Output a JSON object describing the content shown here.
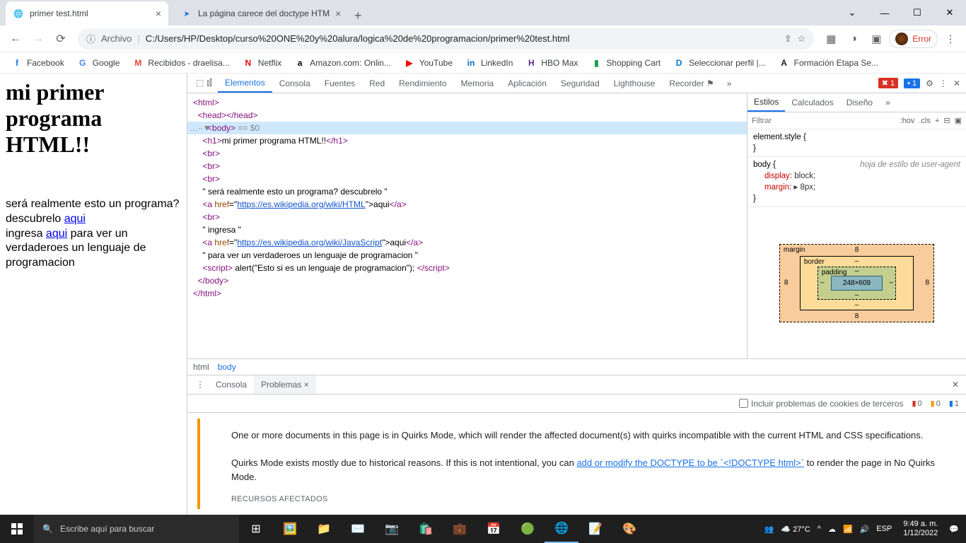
{
  "tabs": [
    {
      "title": "primer test.html",
      "active": true
    },
    {
      "title": "La página carece del doctype HTM",
      "active": false
    }
  ],
  "url": {
    "prefix": "Archivo",
    "path": "C:/Users/HP/Desktop/curso%20ONE%20y%20alura/logica%20de%20programacion/primer%20test.html"
  },
  "errorchip": "Error",
  "bookmarks": [
    {
      "label": "Facebook",
      "color": "#1877f2",
      "letter": "f"
    },
    {
      "label": "Google",
      "color": "#4285f4",
      "letter": "G"
    },
    {
      "label": "Recibidos - draelisa...",
      "color": "#ea4335",
      "letter": "M"
    },
    {
      "label": "Netflix",
      "color": "#e50914",
      "letter": "N"
    },
    {
      "label": "Amazon.com: Onlin...",
      "color": "#000",
      "letter": "a"
    },
    {
      "label": "YouTube",
      "color": "#ff0000",
      "letter": "▶"
    },
    {
      "label": "LinkedIn",
      "color": "#0a66c2",
      "letter": "in"
    },
    {
      "label": "HBO Max",
      "color": "#5a2d82",
      "letter": "H"
    },
    {
      "label": "Shopping Cart",
      "color": "#18a055",
      "letter": "▮"
    },
    {
      "label": "Seleccionar perfil |...",
      "color": "#0078d4",
      "letter": "D"
    },
    {
      "label": "Formación Etapa Se...",
      "color": "#202124",
      "letter": "A"
    }
  ],
  "page": {
    "h1": "mi primer programa HTML!!",
    "p1a": "será realmente esto un programa? descubrelo ",
    "link1": "aqui",
    "p2a": "ingresa ",
    "link2": "aqui",
    "p2b": " para ver un verdaderoes un lenguaje de programacion"
  },
  "devtools": {
    "tabs": [
      "Elementos",
      "Consola",
      "Fuentes",
      "Red",
      "Rendimiento",
      "Memoria",
      "Aplicación",
      "Seguridad",
      "Lighthouse",
      "Recorder ⚑"
    ],
    "active": "Elementos",
    "errors": "1",
    "infos": "1",
    "dom": {
      "html_open": "<html>",
      "head": "<head></head>",
      "body_open": "<body>",
      "body_sel": " == $0",
      "h1_open": "<h1>",
      "h1_text": "mi primer programa HTML!!",
      "h1_close": "</h1>",
      "br": "<br>",
      "txt1": "\" será realmente esto un programa? descubrelo \"",
      "a_open": "<a ",
      "href": "href",
      "eq": "=\"",
      "url1": "https://es.wikipedia.org/wiki/HTML",
      "close_q": "\">",
      "aqui": "aqui",
      "a_close": "</a>",
      "txt2": "\" ingresa \"",
      "url2": "https://es.wikipedia.org/wiki/JavaScript",
      "txt3": "\" para ver un verdaderoes un lenguaje de programacion \"",
      "script_open": "<script>",
      "script_txt": " alert(\"Esto si es un lenguaje de programacion\"); ",
      "script_close": "</script>",
      "body_close": "</body>",
      "html_close": "</html>"
    },
    "crumbs": [
      "html",
      "body"
    ],
    "styles": {
      "tabs": [
        "Estilos",
        "Calculados",
        "Diseño"
      ],
      "filter": "Filtrar",
      "hov": ":hov",
      "cls": ".cls",
      "rule1": "element.style {",
      "rule1b": "}",
      "rule2_sel": "body {",
      "rule2_src": "hoja de estilo de user-agent",
      "prop1": "display",
      "pval1": ": block;",
      "prop2": "margin",
      "pval2": ": ▸ 8px;",
      "rule2b": "}",
      "box": {
        "margin": "margin",
        "border": "border",
        "padding": "padding",
        "dim": "248×609",
        "m": "8",
        "dash": "–"
      }
    },
    "drawer": {
      "tabs": [
        "Consola",
        "Problemas"
      ],
      "active": "Problemas",
      "cookie_label": "Incluir problemas de cookies de terceros",
      "counts": {
        "err": "0",
        "warn": "0",
        "info": "1"
      },
      "quirks_p1": "One or more documents in this page is in Quirks Mode, which will render the affected document(s) with quirks incompatible with the current HTML and CSS specifications.",
      "quirks_p2a": "Quirks Mode exists mostly due to historical reasons. If this is not intentional, you can ",
      "quirks_link": "add or modify the DOCTYPE to be `<!DOCTYPE html>`",
      "quirks_p2b": " to render the page in No Quirks Mode.",
      "quirks_footer": "RECURSOS AFECTADOS"
    }
  },
  "taskbar": {
    "search": "Escribe aquí para buscar",
    "weather": "27°C",
    "lang": "ESP",
    "time": "9:49 a. m.",
    "date": "1/12/2022"
  }
}
